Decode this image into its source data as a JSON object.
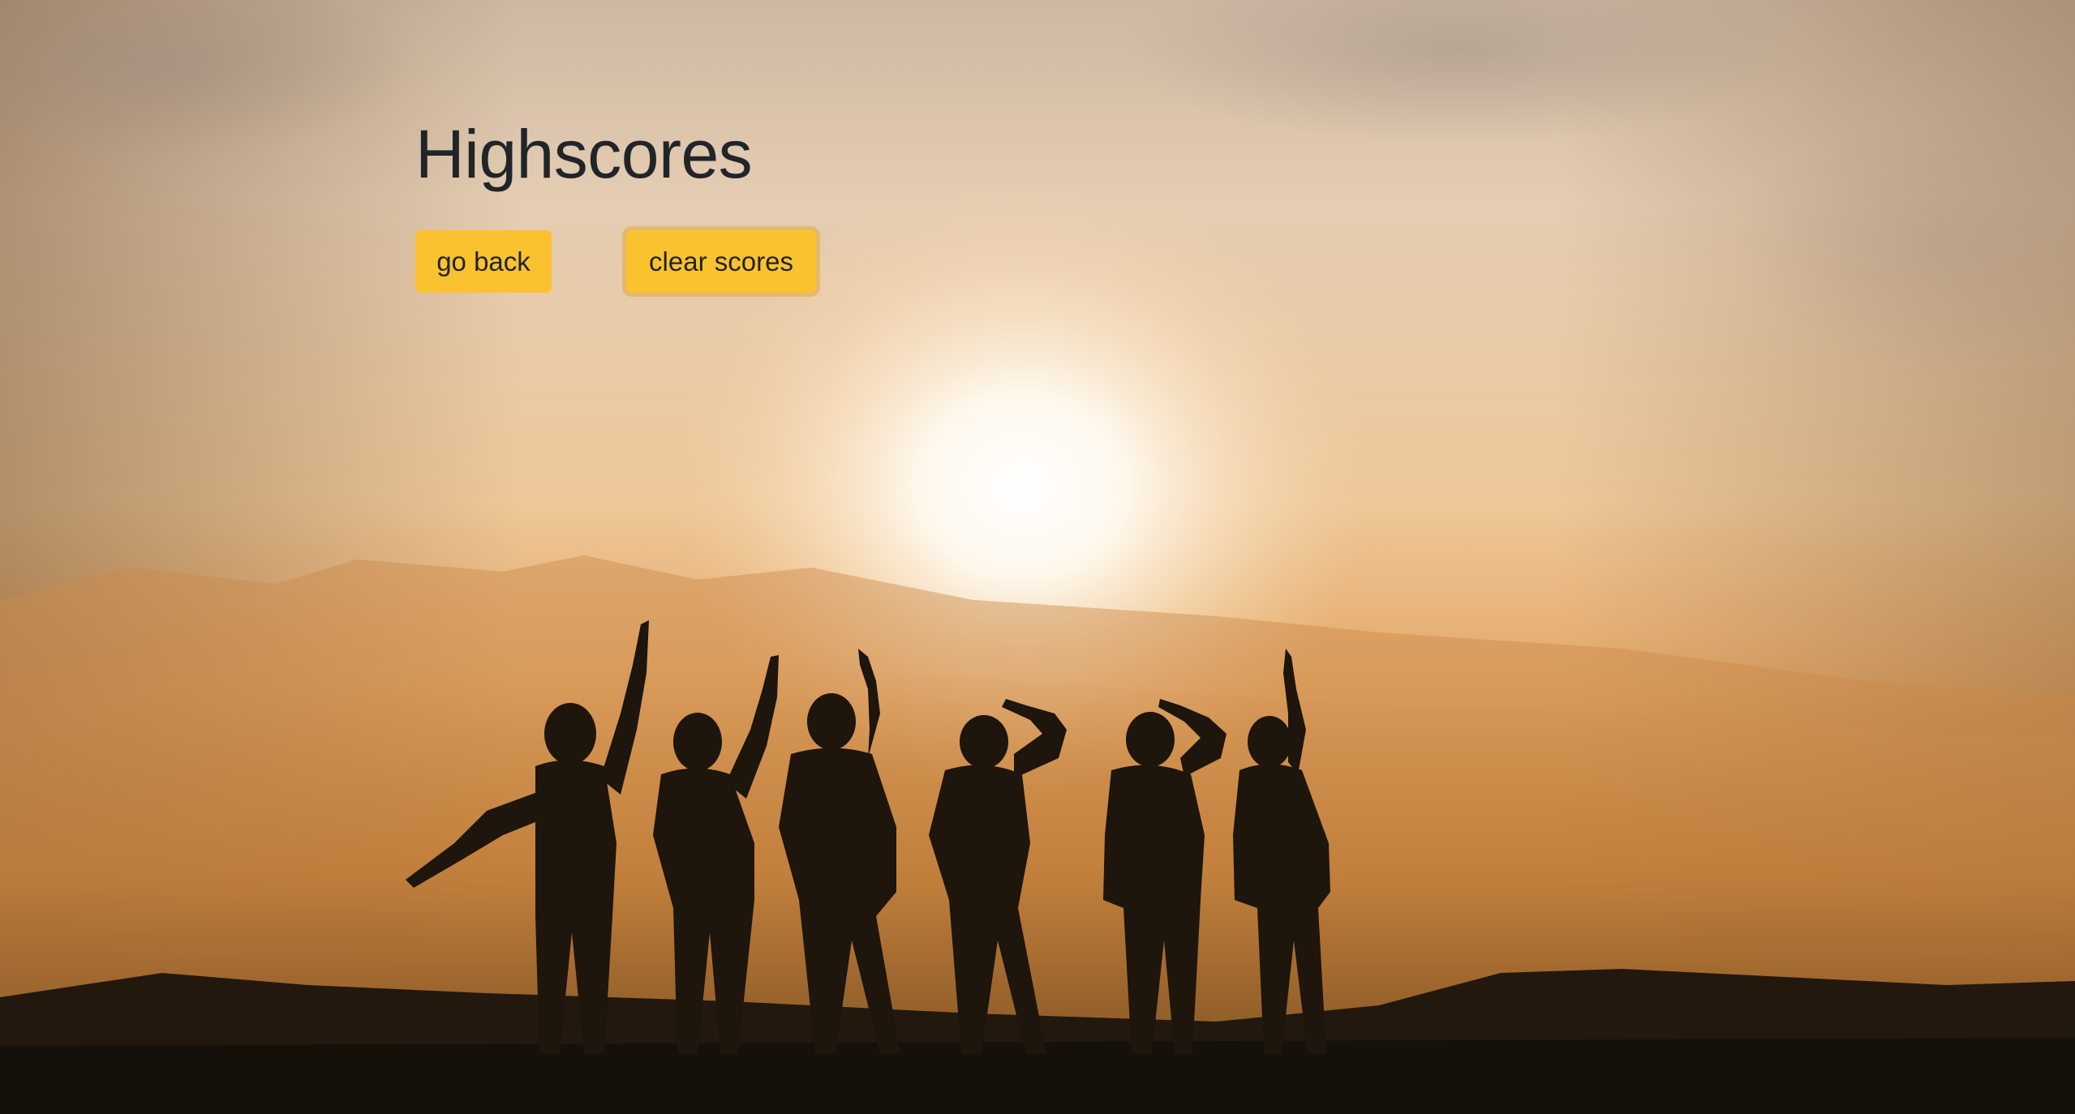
{
  "page": {
    "title": "Highscores"
  },
  "actions": {
    "go_back_label": "go back",
    "clear_scores_label": "clear scores"
  },
  "theme": {
    "button_color": "#fbc22f",
    "text_color": "#212529",
    "background": "sunset photo with silhouettes of six people raising arms on a hilltop"
  }
}
